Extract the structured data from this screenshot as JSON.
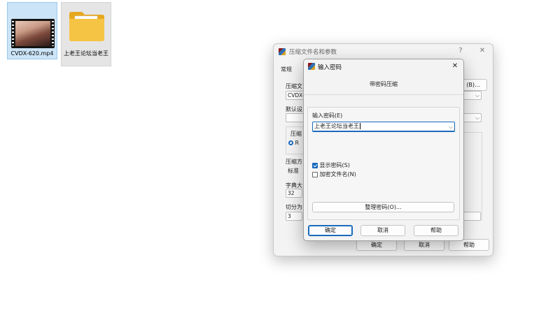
{
  "desktop": {
    "icons": [
      {
        "label": "CVDX-620.mp4",
        "icon": "video-thumbnail"
      },
      {
        "label": "上老王论坛当老王",
        "icon": "folder-icon"
      }
    ]
  },
  "back_dialog": {
    "title": "压缩文件名和参数",
    "help_symbol": "?",
    "close_symbol": "✕",
    "tab_general": "常规",
    "archive_label": "压缩文",
    "archive_value": "CVDX-6",
    "browse_button": "(B)...",
    "default_label": "默认设",
    "update_label": "压缩",
    "format_radio": "R",
    "method_label": "压缩方",
    "method_value": "标准",
    "dict_label": "字典大",
    "dict_value": "32",
    "split_label": "切分为",
    "split_value": "3",
    "ok": "确定",
    "cancel": "取消",
    "help": "帮助"
  },
  "password_dialog": {
    "title": "输入密码",
    "close_symbol": "✕",
    "heading": "带密码压缩",
    "password_label": "输入密码(E)",
    "password_value": "上老王论坛当老王",
    "show_password_label": "显示密码(S)",
    "show_password_checked": true,
    "encrypt_names_label": "加密文件名(N)",
    "encrypt_names_checked": false,
    "organize_button": "整理密码(O)...",
    "ok": "确定",
    "cancel": "取消",
    "help": "帮助"
  },
  "colors": {
    "accent": "#1a6bbd",
    "selection": "#cce4f7",
    "dialog_bg": "#f3f3f3"
  }
}
